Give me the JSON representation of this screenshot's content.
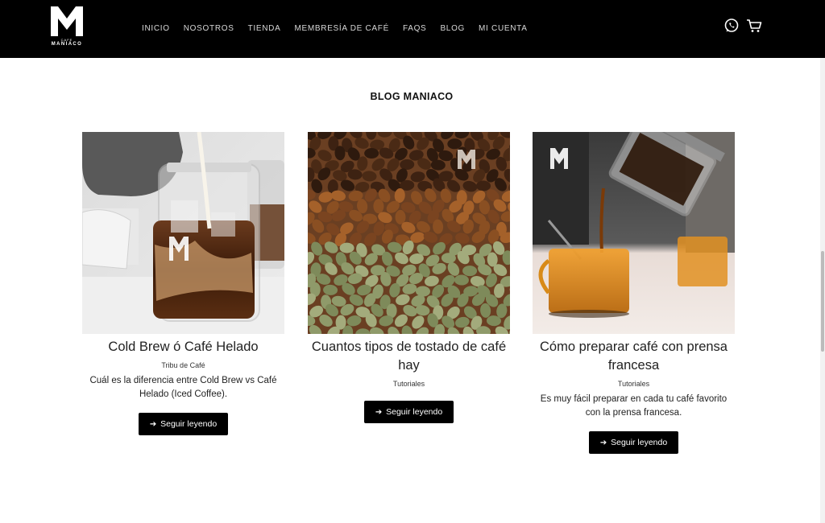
{
  "brand": {
    "logo_letter": "M",
    "logo_small": "CAFE",
    "logo_name": "MANIACO"
  },
  "nav": [
    {
      "label": "INICIO"
    },
    {
      "label": "NOSOTROS"
    },
    {
      "label": "TIENDA"
    },
    {
      "label": "MEMBRESÍA DE CAFÉ"
    },
    {
      "label": "FAQS"
    },
    {
      "label": "BLOG"
    },
    {
      "label": "MI CUENTA"
    }
  ],
  "header_icons": [
    "whatsapp-icon",
    "cart-icon"
  ],
  "section": {
    "title": "BLOG MANIACO"
  },
  "posts": [
    {
      "title": "Cold Brew ó Café Helado",
      "category": "Tribu de Café",
      "excerpt": "Cuál es la diferencia entre Cold Brew vs Café Helado (Iced Coffee).",
      "button": "Seguir leyendo",
      "image": "cold-brew-jar-photo"
    },
    {
      "title": "Cuantos tipos de tostado de café hay",
      "category": "Tutoriales",
      "excerpt": "",
      "button": "Seguir leyendo",
      "image": "coffee-beans-photo"
    },
    {
      "title": "Cómo preparar café con prensa francesa",
      "category": "Tutoriales",
      "excerpt": "Es muy fácil preparar en cada tu café favorito con la prensa francesa.",
      "button": "Seguir leyendo",
      "image": "french-press-pour-photo"
    }
  ],
  "colors": {
    "header_bg": "#000000",
    "button_bg": "#000000",
    "page_bg": "#ffffff"
  }
}
